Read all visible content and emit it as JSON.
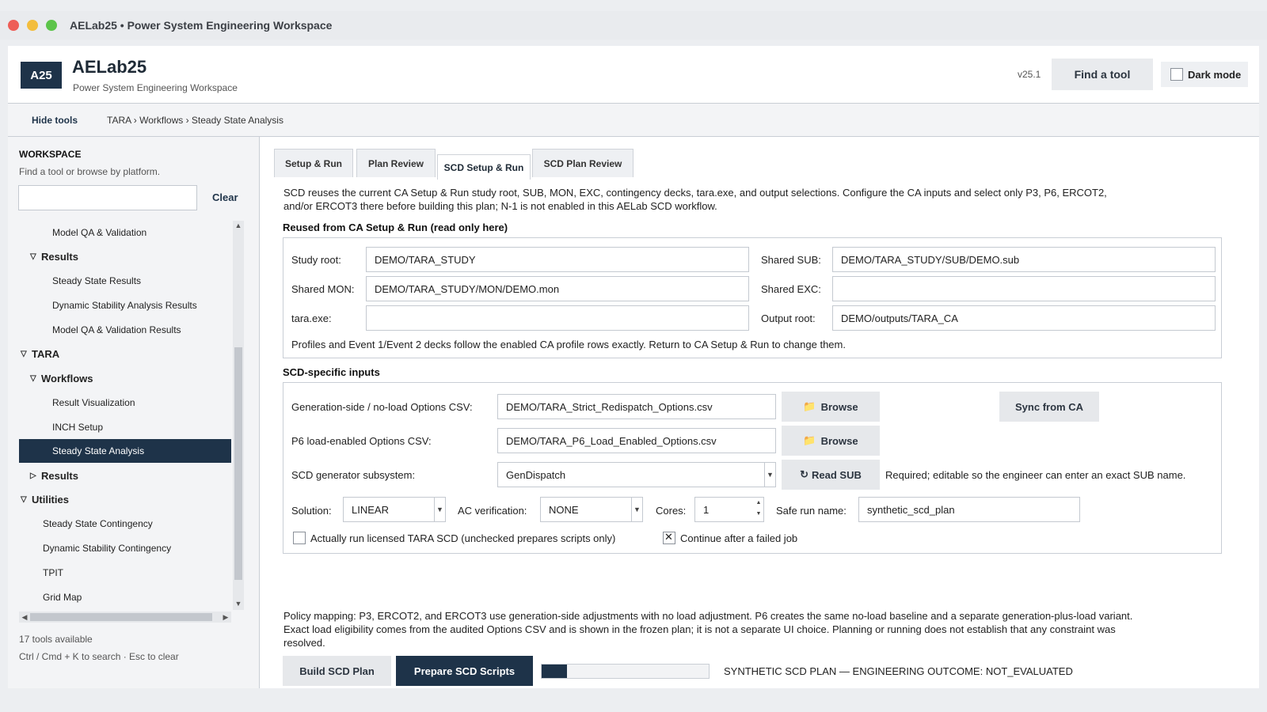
{
  "window": {
    "title": "AELab25 • Power System Engineering Workspace"
  },
  "header": {
    "logo": "A25",
    "app_name": "AELab25",
    "app_subtitle": "Power System Engineering Workspace",
    "version": "v25.1",
    "find_tool": "Find a tool",
    "dark_mode_label": "Dark mode",
    "dark_mode_checked": false
  },
  "breadcrumb_bar": {
    "hide_tools": "Hide tools",
    "path": "TARA › Workflows › Steady State Analysis"
  },
  "sidebar": {
    "title": "WORKSPACE",
    "subtitle": "Find a tool or browse by platform.",
    "search_value": "",
    "clear_label": "Clear",
    "tree": [
      {
        "label": "Model QA & Validation",
        "level": 2,
        "caret": ""
      },
      {
        "label": "Results",
        "level": 1,
        "caret": "open"
      },
      {
        "label": "Steady State Results",
        "level": 2,
        "caret": ""
      },
      {
        "label": "Dynamic Stability Analysis Results",
        "level": 2,
        "caret": ""
      },
      {
        "label": "Model QA & Validation Results",
        "level": 2,
        "caret": ""
      },
      {
        "label": "TARA",
        "level": 0,
        "caret": "open"
      },
      {
        "label": "Workflows",
        "level": 1,
        "caret": "open"
      },
      {
        "label": "Result Visualization",
        "level": 2,
        "caret": ""
      },
      {
        "label": "INCH Setup",
        "level": 2,
        "caret": ""
      },
      {
        "label": "Steady State Analysis",
        "level": 2,
        "caret": "",
        "selected": true
      },
      {
        "label": "Results",
        "level": 1,
        "caret": "closed"
      },
      {
        "label": "Utilities",
        "level": 0,
        "caret": "open"
      },
      {
        "label": "Steady State Contingency",
        "level": 1.5,
        "caret": ""
      },
      {
        "label": "Dynamic Stability Contingency",
        "level": 1.5,
        "caret": ""
      },
      {
        "label": "TPIT",
        "level": 1.5,
        "caret": ""
      },
      {
        "label": "Grid Map",
        "level": 1.5,
        "caret": ""
      }
    ],
    "tools_count": "17 tools available",
    "shortcut_hint": "Ctrl / Cmd + K to search · Esc to clear"
  },
  "tabs": [
    {
      "label": "Setup & Run",
      "active": false
    },
    {
      "label": "Plan Review",
      "active": false
    },
    {
      "label": "SCD Setup & Run",
      "active": true
    },
    {
      "label": "SCD Plan Review",
      "active": false
    }
  ],
  "main": {
    "description": "SCD reuses the current CA Setup & Run study root, SUB, MON, EXC, contingency decks, tara.exe, and output selections. Configure the CA inputs and select only P3, P6, ERCOT2, and/or ERCOT3 there before building this plan; N-1 is not enabled in this AELab SCD workflow.",
    "reused": {
      "title": "Reused from CA Setup & Run (read only here)",
      "study_root_label": "Study root:",
      "study_root": "DEMO/TARA_STUDY",
      "shared_sub_label": "Shared SUB:",
      "shared_sub": "DEMO/TARA_STUDY/SUB/DEMO.sub",
      "shared_mon_label": "Shared MON:",
      "shared_mon": "DEMO/TARA_STUDY/MON/DEMO.mon",
      "shared_exc_label": "Shared EXC:",
      "shared_exc": "",
      "tara_exe_label": "tara.exe:",
      "tara_exe": "",
      "output_root_label": "Output root:",
      "output_root": "DEMO/outputs/TARA_CA",
      "note": "Profiles and Event 1/Event 2 decks follow the enabled CA profile rows exactly. Return to CA Setup & Run to change them."
    },
    "scd": {
      "title": "SCD-specific inputs",
      "gen_csv_label": "Generation-side / no-load Options CSV:",
      "gen_csv": "DEMO/TARA_Strict_Redispatch_Options.csv",
      "browse_label": "Browse",
      "sync_label": "Sync from CA",
      "p6_csv_label": "P6 load-enabled Options CSV:",
      "p6_csv": "DEMO/TARA_P6_Load_Enabled_Options.csv",
      "subsystem_label": "SCD generator subsystem:",
      "subsystem": "GenDispatch",
      "read_sub_label": "Read SUB",
      "subsystem_hint": "Required; editable so the engineer can enter an exact SUB name.",
      "solution_label": "Solution:",
      "solution": "LINEAR",
      "ac_label": "AC verification:",
      "ac": "NONE",
      "cores_label": "Cores:",
      "cores": "1",
      "safe_name_label": "Safe run name:",
      "safe_name": "synthetic_scd_plan",
      "run_licensed_label": "Actually run licensed TARA SCD (unchecked prepares scripts only)",
      "run_licensed_checked": false,
      "continue_label": "Continue after a failed job",
      "continue_checked": true
    },
    "policy": "Policy mapping: P3, ERCOT2, and ERCOT3 use generation-side adjustments with no load adjustment. P6 creates the same no-load baseline and a separate generation-plus-load variant. Exact load eligibility comes from the audited Options CSV and is shown in the frozen plan; it is not a separate UI choice. Planning or running does not establish that any constraint was resolved.",
    "build_label": "Build SCD Plan",
    "prepare_label": "Prepare SCD Scripts",
    "progress": 0.15,
    "status": "SYNTHETIC SCD PLAN — ENGINEERING OUTCOME: NOT_EVALUATED"
  },
  "colors": {
    "accent": "#1e3349"
  }
}
